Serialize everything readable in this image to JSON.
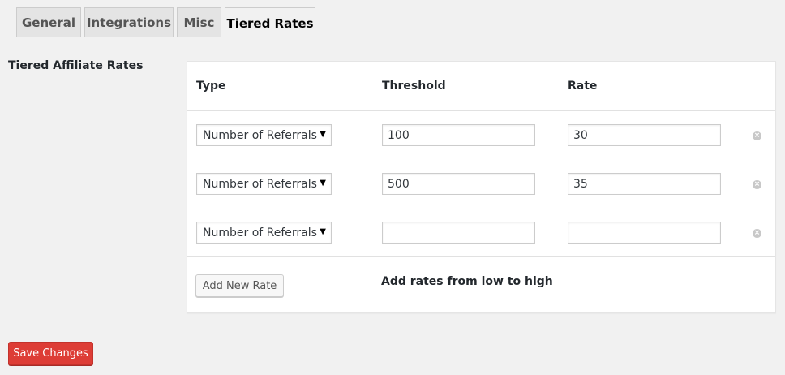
{
  "tabs": [
    {
      "label": "General"
    },
    {
      "label": "Integrations"
    },
    {
      "label": "Misc"
    },
    {
      "label": "Tiered Rates",
      "active": true
    }
  ],
  "section": {
    "label": "Tiered Affiliate Rates"
  },
  "table": {
    "headers": {
      "type": "Type",
      "threshold": "Threshold",
      "rate": "Rate"
    },
    "rows": [
      {
        "type": "Number of Referrals",
        "threshold": "100",
        "rate": "30"
      },
      {
        "type": "Number of Referrals",
        "threshold": "500",
        "rate": "35"
      },
      {
        "type": "Number of Referrals",
        "threshold": "",
        "rate": ""
      }
    ],
    "remove_icon": "circle-x-icon"
  },
  "footer": {
    "add_button": "Add New Rate",
    "hint": "Add rates from low to high"
  },
  "save_button": "Save Changes",
  "colors": {
    "save": "#dd3d36",
    "background": "#f1f1f1"
  }
}
